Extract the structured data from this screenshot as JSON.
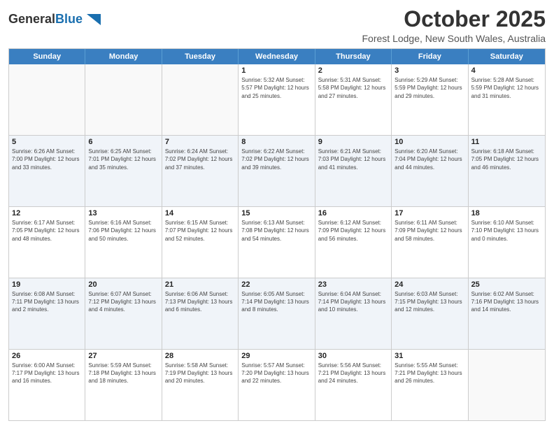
{
  "header": {
    "logo_general": "General",
    "logo_blue": "Blue",
    "month_title": "October 2025",
    "location": "Forest Lodge, New South Wales, Australia"
  },
  "day_headers": [
    "Sunday",
    "Monday",
    "Tuesday",
    "Wednesday",
    "Thursday",
    "Friday",
    "Saturday"
  ],
  "weeks": [
    {
      "alt": false,
      "days": [
        {
          "num": "",
          "info": ""
        },
        {
          "num": "",
          "info": ""
        },
        {
          "num": "",
          "info": ""
        },
        {
          "num": "1",
          "info": "Sunrise: 5:32 AM\nSunset: 5:57 PM\nDaylight: 12 hours\nand 25 minutes."
        },
        {
          "num": "2",
          "info": "Sunrise: 5:31 AM\nSunset: 5:58 PM\nDaylight: 12 hours\nand 27 minutes."
        },
        {
          "num": "3",
          "info": "Sunrise: 5:29 AM\nSunset: 5:59 PM\nDaylight: 12 hours\nand 29 minutes."
        },
        {
          "num": "4",
          "info": "Sunrise: 5:28 AM\nSunset: 5:59 PM\nDaylight: 12 hours\nand 31 minutes."
        }
      ]
    },
    {
      "alt": true,
      "days": [
        {
          "num": "5",
          "info": "Sunrise: 6:26 AM\nSunset: 7:00 PM\nDaylight: 12 hours\nand 33 minutes."
        },
        {
          "num": "6",
          "info": "Sunrise: 6:25 AM\nSunset: 7:01 PM\nDaylight: 12 hours\nand 35 minutes."
        },
        {
          "num": "7",
          "info": "Sunrise: 6:24 AM\nSunset: 7:02 PM\nDaylight: 12 hours\nand 37 minutes."
        },
        {
          "num": "8",
          "info": "Sunrise: 6:22 AM\nSunset: 7:02 PM\nDaylight: 12 hours\nand 39 minutes."
        },
        {
          "num": "9",
          "info": "Sunrise: 6:21 AM\nSunset: 7:03 PM\nDaylight: 12 hours\nand 41 minutes."
        },
        {
          "num": "10",
          "info": "Sunrise: 6:20 AM\nSunset: 7:04 PM\nDaylight: 12 hours\nand 44 minutes."
        },
        {
          "num": "11",
          "info": "Sunrise: 6:18 AM\nSunset: 7:05 PM\nDaylight: 12 hours\nand 46 minutes."
        }
      ]
    },
    {
      "alt": false,
      "days": [
        {
          "num": "12",
          "info": "Sunrise: 6:17 AM\nSunset: 7:05 PM\nDaylight: 12 hours\nand 48 minutes."
        },
        {
          "num": "13",
          "info": "Sunrise: 6:16 AM\nSunset: 7:06 PM\nDaylight: 12 hours\nand 50 minutes."
        },
        {
          "num": "14",
          "info": "Sunrise: 6:15 AM\nSunset: 7:07 PM\nDaylight: 12 hours\nand 52 minutes."
        },
        {
          "num": "15",
          "info": "Sunrise: 6:13 AM\nSunset: 7:08 PM\nDaylight: 12 hours\nand 54 minutes."
        },
        {
          "num": "16",
          "info": "Sunrise: 6:12 AM\nSunset: 7:09 PM\nDaylight: 12 hours\nand 56 minutes."
        },
        {
          "num": "17",
          "info": "Sunrise: 6:11 AM\nSunset: 7:09 PM\nDaylight: 12 hours\nand 58 minutes."
        },
        {
          "num": "18",
          "info": "Sunrise: 6:10 AM\nSunset: 7:10 PM\nDaylight: 13 hours\nand 0 minutes."
        }
      ]
    },
    {
      "alt": true,
      "days": [
        {
          "num": "19",
          "info": "Sunrise: 6:08 AM\nSunset: 7:11 PM\nDaylight: 13 hours\nand 2 minutes."
        },
        {
          "num": "20",
          "info": "Sunrise: 6:07 AM\nSunset: 7:12 PM\nDaylight: 13 hours\nand 4 minutes."
        },
        {
          "num": "21",
          "info": "Sunrise: 6:06 AM\nSunset: 7:13 PM\nDaylight: 13 hours\nand 6 minutes."
        },
        {
          "num": "22",
          "info": "Sunrise: 6:05 AM\nSunset: 7:14 PM\nDaylight: 13 hours\nand 8 minutes."
        },
        {
          "num": "23",
          "info": "Sunrise: 6:04 AM\nSunset: 7:14 PM\nDaylight: 13 hours\nand 10 minutes."
        },
        {
          "num": "24",
          "info": "Sunrise: 6:03 AM\nSunset: 7:15 PM\nDaylight: 13 hours\nand 12 minutes."
        },
        {
          "num": "25",
          "info": "Sunrise: 6:02 AM\nSunset: 7:16 PM\nDaylight: 13 hours\nand 14 minutes."
        }
      ]
    },
    {
      "alt": false,
      "days": [
        {
          "num": "26",
          "info": "Sunrise: 6:00 AM\nSunset: 7:17 PM\nDaylight: 13 hours\nand 16 minutes."
        },
        {
          "num": "27",
          "info": "Sunrise: 5:59 AM\nSunset: 7:18 PM\nDaylight: 13 hours\nand 18 minutes."
        },
        {
          "num": "28",
          "info": "Sunrise: 5:58 AM\nSunset: 7:19 PM\nDaylight: 13 hours\nand 20 minutes."
        },
        {
          "num": "29",
          "info": "Sunrise: 5:57 AM\nSunset: 7:20 PM\nDaylight: 13 hours\nand 22 minutes."
        },
        {
          "num": "30",
          "info": "Sunrise: 5:56 AM\nSunset: 7:21 PM\nDaylight: 13 hours\nand 24 minutes."
        },
        {
          "num": "31",
          "info": "Sunrise: 5:55 AM\nSunset: 7:21 PM\nDaylight: 13 hours\nand 26 minutes."
        },
        {
          "num": "",
          "info": ""
        }
      ]
    }
  ]
}
